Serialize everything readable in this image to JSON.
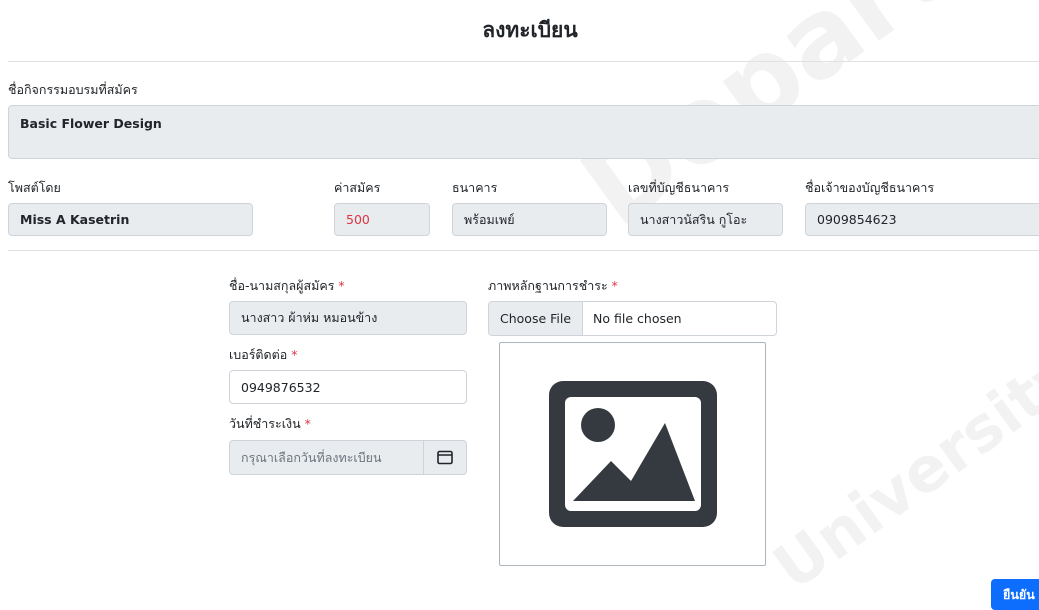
{
  "page_title": "ลงทะเบียน",
  "activity": {
    "label": "ชื่อกิจกรรมอบรมที่สมัคร",
    "value": "Basic Flower Design"
  },
  "info": {
    "posted_by_label": "โพสต์โดย",
    "posted_by_value": "Miss A Kasetrin",
    "fee_label": "ค่าสมัคร",
    "fee_value": "500",
    "bank_label": "ธนาคาร",
    "bank_value": "พร้อมเพย์",
    "account_no_label": "เลขที่บัญชีธนาคาร",
    "account_no_value": "นางสาวนัสริน กูโอะ",
    "account_owner_label": "ชื่อเจ้าของบัญชีธนาคาร",
    "account_owner_value": "0909854623"
  },
  "form": {
    "name_label": "ชื่อ-นามสกุลผู้สมัคร",
    "name_value": "นางสาว ผ้าห่ม หมอนข้าง",
    "phone_label": "เบอร์ติดต่อ",
    "phone_value": "0949876532",
    "pay_date_label": "วันที่ชำระเงิน",
    "pay_date_placeholder": "กรุณาเลือกวันที่ลงทะเบียน",
    "required_mark": "*",
    "slip_label": "ภาพหลักฐานการชำระ",
    "choose_file_label": "Choose File",
    "no_file_text": "No file chosen",
    "preview_icon": "image-placeholder-icon",
    "calendar_icon": "calendar-icon"
  },
  "actions": {
    "confirm_label": "ยืนยัน"
  },
  "watermark": {
    "line1": "Department",
    "line2": "University"
  },
  "colors": {
    "primary": "#0d6efd",
    "required": "#dc3545",
    "readonly_bg": "#e9ecef",
    "border": "#ced4da"
  }
}
